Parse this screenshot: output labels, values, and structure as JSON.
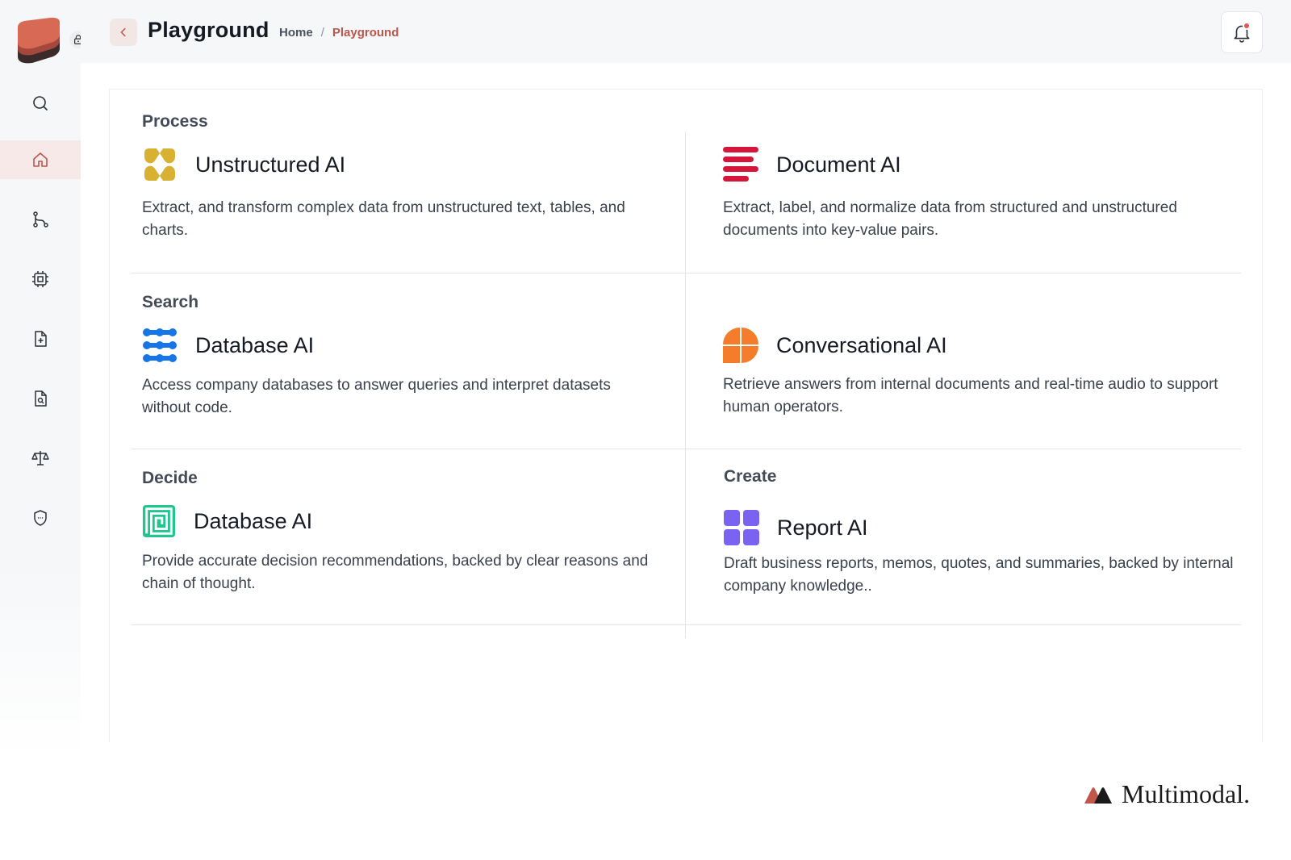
{
  "header": {
    "title": "Playground",
    "breadcrumb": {
      "home": "Home",
      "separator": "/",
      "current": "Playground"
    }
  },
  "sidebar": {
    "items": [
      {
        "icon": "search-icon"
      },
      {
        "icon": "home-icon",
        "active": true
      },
      {
        "icon": "workflow-icon"
      },
      {
        "icon": "chip-icon"
      },
      {
        "icon": "file-add-icon"
      },
      {
        "icon": "file-search-icon"
      },
      {
        "icon": "scale-icon"
      },
      {
        "icon": "shield-icon"
      }
    ]
  },
  "sections": {
    "process": {
      "label": "Process",
      "products": [
        {
          "name": "Unstructured AI",
          "icon": "unstructured-ai-icon",
          "color": "#d9b132",
          "description": "Extract, and transform complex data from unstructured text, tables, and charts."
        },
        {
          "name": "Document AI",
          "icon": "document-ai-icon",
          "color": "#d6153a",
          "description": "Extract, label, and normalize data from structured and unstructured documents into key-value pairs."
        }
      ]
    },
    "search": {
      "label": "Search",
      "products": [
        {
          "name": "Database AI",
          "icon": "database-ai-icon",
          "color": "#1676e8",
          "description": "Access company databases to answer queries and interpret datasets without code."
        },
        {
          "name": "Conversational AI",
          "icon": "conversational-ai-icon",
          "color": "#f47c2a",
          "description": "Retrieve answers from internal documents and real-time audio to support human operators."
        }
      ]
    },
    "decide": {
      "label": "Decide",
      "products": [
        {
          "name": "Database AI",
          "icon": "decision-ai-icon",
          "color": "#22c58f",
          "description": "Provide accurate decision recommendations, backed by clear reasons and chain of thought."
        }
      ]
    },
    "create": {
      "label": "Create",
      "products": [
        {
          "name": "Report AI",
          "icon": "report-ai-icon",
          "color": "#7b63f2",
          "description": "Draft business reports, memos, quotes, and summaries, backed by internal company knowledge.."
        }
      ]
    }
  },
  "brand": {
    "name": "Multimodal."
  },
  "colors": {
    "accent": "#b9574c",
    "active_bg": "#f7e9e8"
  }
}
